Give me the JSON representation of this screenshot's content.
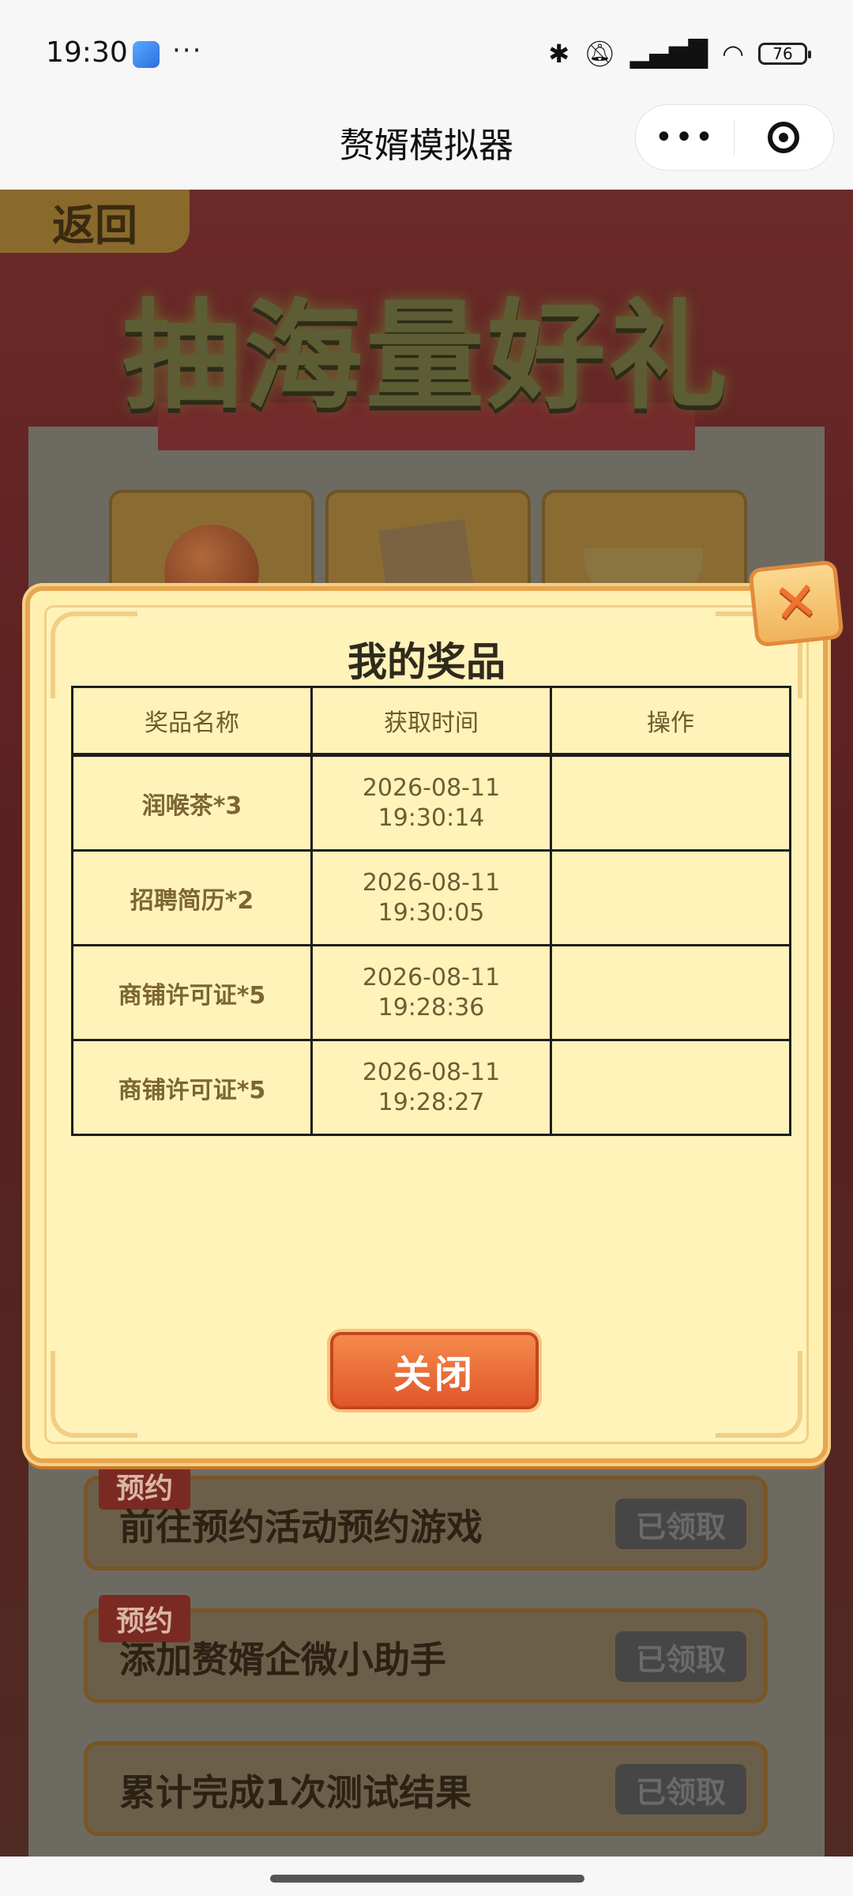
{
  "status_bar": {
    "time": "19:30",
    "more": "···",
    "icons": [
      "bluetooth-icon",
      "silent-bell-icon",
      "hd-signal-icon",
      "wifi-icon"
    ],
    "battery": "76"
  },
  "nav": {
    "title": "赘婿模拟器",
    "more_label": "•••"
  },
  "page": {
    "back_label": "返回",
    "hero_title": "抽海量好礼",
    "tasks": [
      {
        "tag": "预约",
        "text": "前往预约活动预约游戏",
        "status": "已领取"
      },
      {
        "tag": "预约",
        "text": "添加赘婿企微小助手",
        "status": "已领取"
      },
      {
        "tag": "",
        "text": "累计完成1次测试结果",
        "status": "已领取"
      }
    ]
  },
  "modal": {
    "title": "我的奖品",
    "close_symbol": "✕",
    "headers": [
      "奖品名称",
      "获取时间",
      "操作"
    ],
    "rows": [
      {
        "name": "润喉茶*3",
        "date": "2026-08-11",
        "time": "19:30:14",
        "action": ""
      },
      {
        "name": "招聘简历*2",
        "date": "2026-08-11",
        "time": "19:30:05",
        "action": ""
      },
      {
        "name": "商铺许可证*5",
        "date": "2026-08-11",
        "time": "19:28:36",
        "action": ""
      },
      {
        "name": "商铺许可证*5",
        "date": "2026-08-11",
        "time": "19:28:27",
        "action": ""
      }
    ],
    "close_button": "关闭"
  },
  "colors": {
    "modal_bg": "#fff0b0",
    "modal_border": "#e6a650",
    "button_orange": "#e0562a",
    "claimed_gray": "#474646"
  }
}
